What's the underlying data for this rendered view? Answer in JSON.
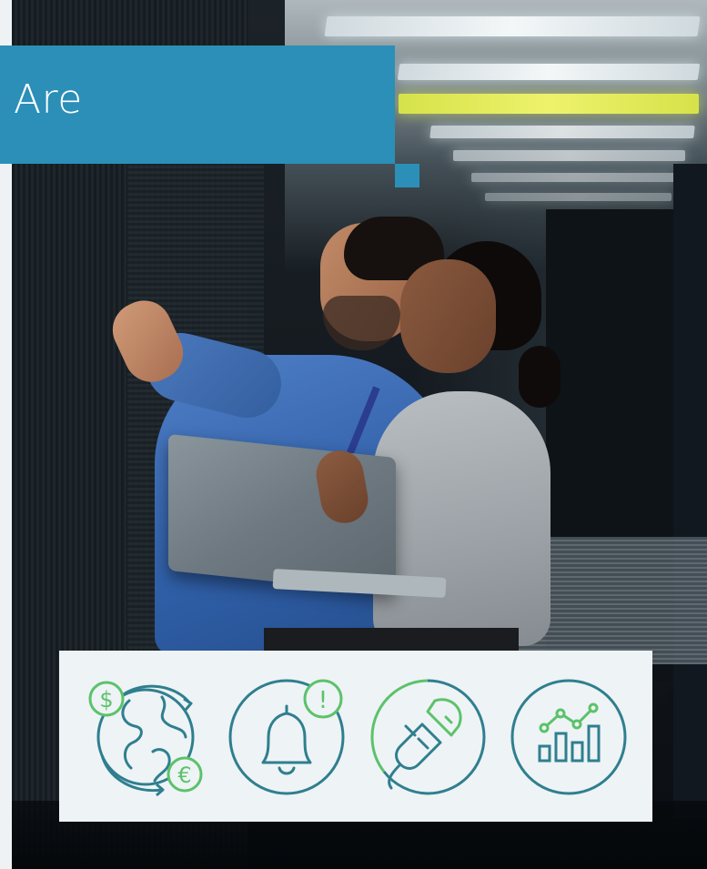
{
  "banner": {
    "title": "Are"
  },
  "photo": {
    "description_icon": "data-center-photo"
  },
  "icons": [
    {
      "name": "globe-currency-icon",
      "symbols": [
        "$",
        "€"
      ]
    },
    {
      "name": "bell-alert-icon",
      "symbols": [
        "!"
      ]
    },
    {
      "name": "power-plug-icon",
      "symbols": []
    },
    {
      "name": "bar-chart-trend-icon",
      "symbols": []
    }
  ],
  "colors": {
    "brand_blue": "#2b8fb8",
    "icon_teal": "#2f7f8e",
    "icon_green": "#5cc26a",
    "panel_bg": "#eef3f6"
  }
}
